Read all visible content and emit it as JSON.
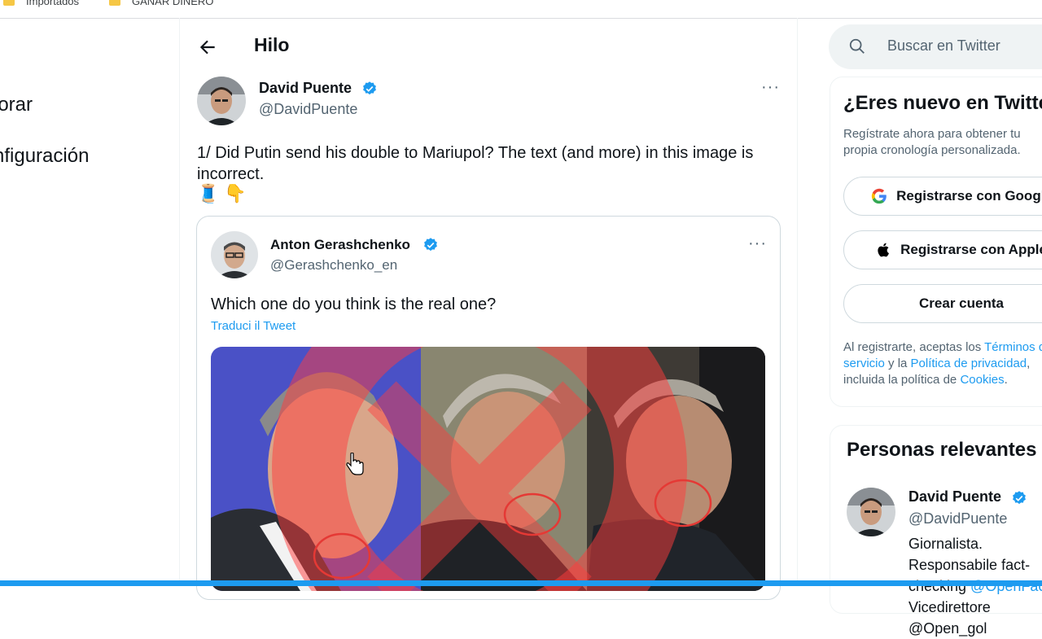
{
  "bookmarks": [
    {
      "label": "Importados"
    },
    {
      "label": "GANAR DINERO"
    }
  ],
  "nav": {
    "explore": "lorar",
    "settings": "nfiguración"
  },
  "header": {
    "title": "Hilo",
    "back_icon": "arrow-left-icon"
  },
  "tweet": {
    "author_name": "David Puente",
    "author_handle": "@DavidPuente",
    "text": "1/ Did Putin send his double to Mariupol? The text (and more) in this image is incorrect.",
    "emojis": [
      "🧵",
      "👇"
    ],
    "more": "···"
  },
  "quote": {
    "author_name": "Anton Gerashchenko",
    "author_handle": "@Gerashchenko_en",
    "text": "Which one do you think is the real one?",
    "translate": "Traduci il Tweet",
    "more": "···"
  },
  "search": {
    "placeholder": "Buscar en Twitter"
  },
  "new_panel": {
    "title": "¿Eres nuevo en Twitter?",
    "subtitle": "Regístrate ahora para obtener tu propia cronología personalizada.",
    "google_label": "Registrarse con Google",
    "apple_label": "Registrarse con Apple",
    "create_label": "Crear cuenta",
    "legal_prefix": "Al registrarte, aceptas los ",
    "terms": "Términos de servicio",
    "and": " y la ",
    "privacy": "Política de privacidad",
    "legal_mid": ", incluida la política de ",
    "cookies": "Cookies",
    "legal_end": "."
  },
  "relevant": {
    "title": "Personas relevantes",
    "name": "David Puente",
    "handle": "@DavidPuente",
    "bio_start": "Giornalista. Responsabile fact-checking ",
    "bio_link": "@OpenFacts",
    "bio_end": " Vicedirettore @Open_gol"
  },
  "colors": {
    "accent": "#1d9bf0",
    "text": "#0f1419",
    "muted": "#536471"
  }
}
